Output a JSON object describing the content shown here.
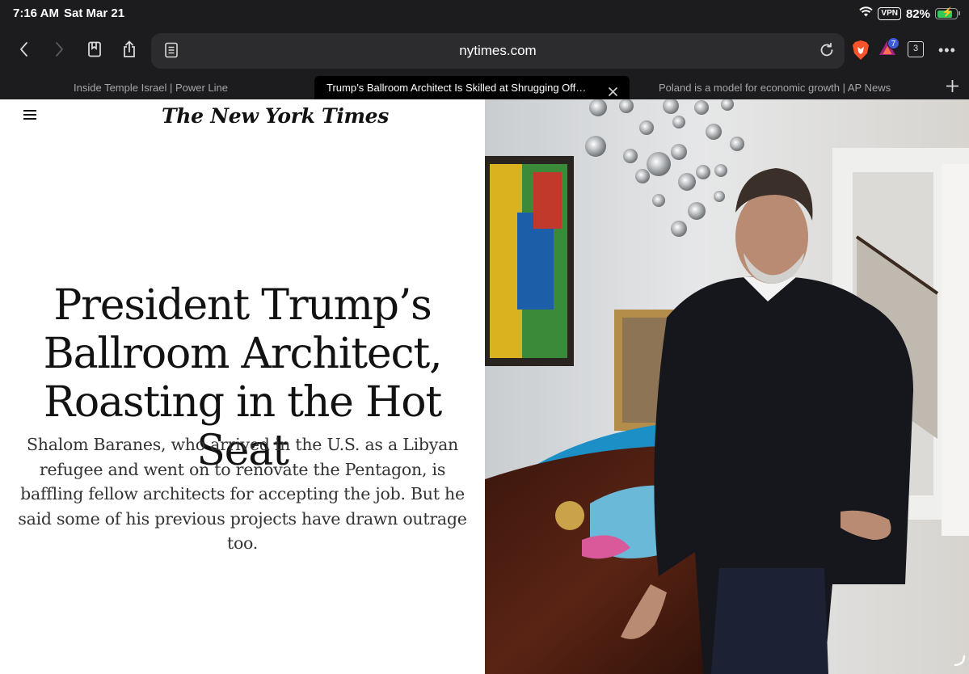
{
  "status": {
    "time": "7:16 AM",
    "date": "Sat Mar 21",
    "vpn": "VPN",
    "battery_percent": "82%",
    "battery_level": 0.82
  },
  "toolbar": {
    "url": "nytimes.com",
    "rewards_badge": "7",
    "tab_count": "3"
  },
  "tabs": [
    {
      "label": "Inside Temple Israel | Power Line",
      "active": false
    },
    {
      "label": "Trump’s Ballroom Architect Is Skilled at Shrugging Off…",
      "active": true
    },
    {
      "label": "Poland is a model for economic growth | AP News",
      "active": false
    }
  ],
  "article": {
    "masthead": "The New York Times",
    "headline": "President Trump’s Ballroom Architect, Roasting in the Hot Seat",
    "summary": "Shalom Baranes, who arrived in the U.S. as a Libyan refugee and went on to renovate the Pentagon, is baffling fellow architects for accepting the job. But he said some of his previous projects have drawn outrage too."
  },
  "colors": {
    "chrome": "#1c1c1e",
    "addressbar": "#2c2c2e",
    "battery": "#34c759",
    "text": "#121212"
  }
}
